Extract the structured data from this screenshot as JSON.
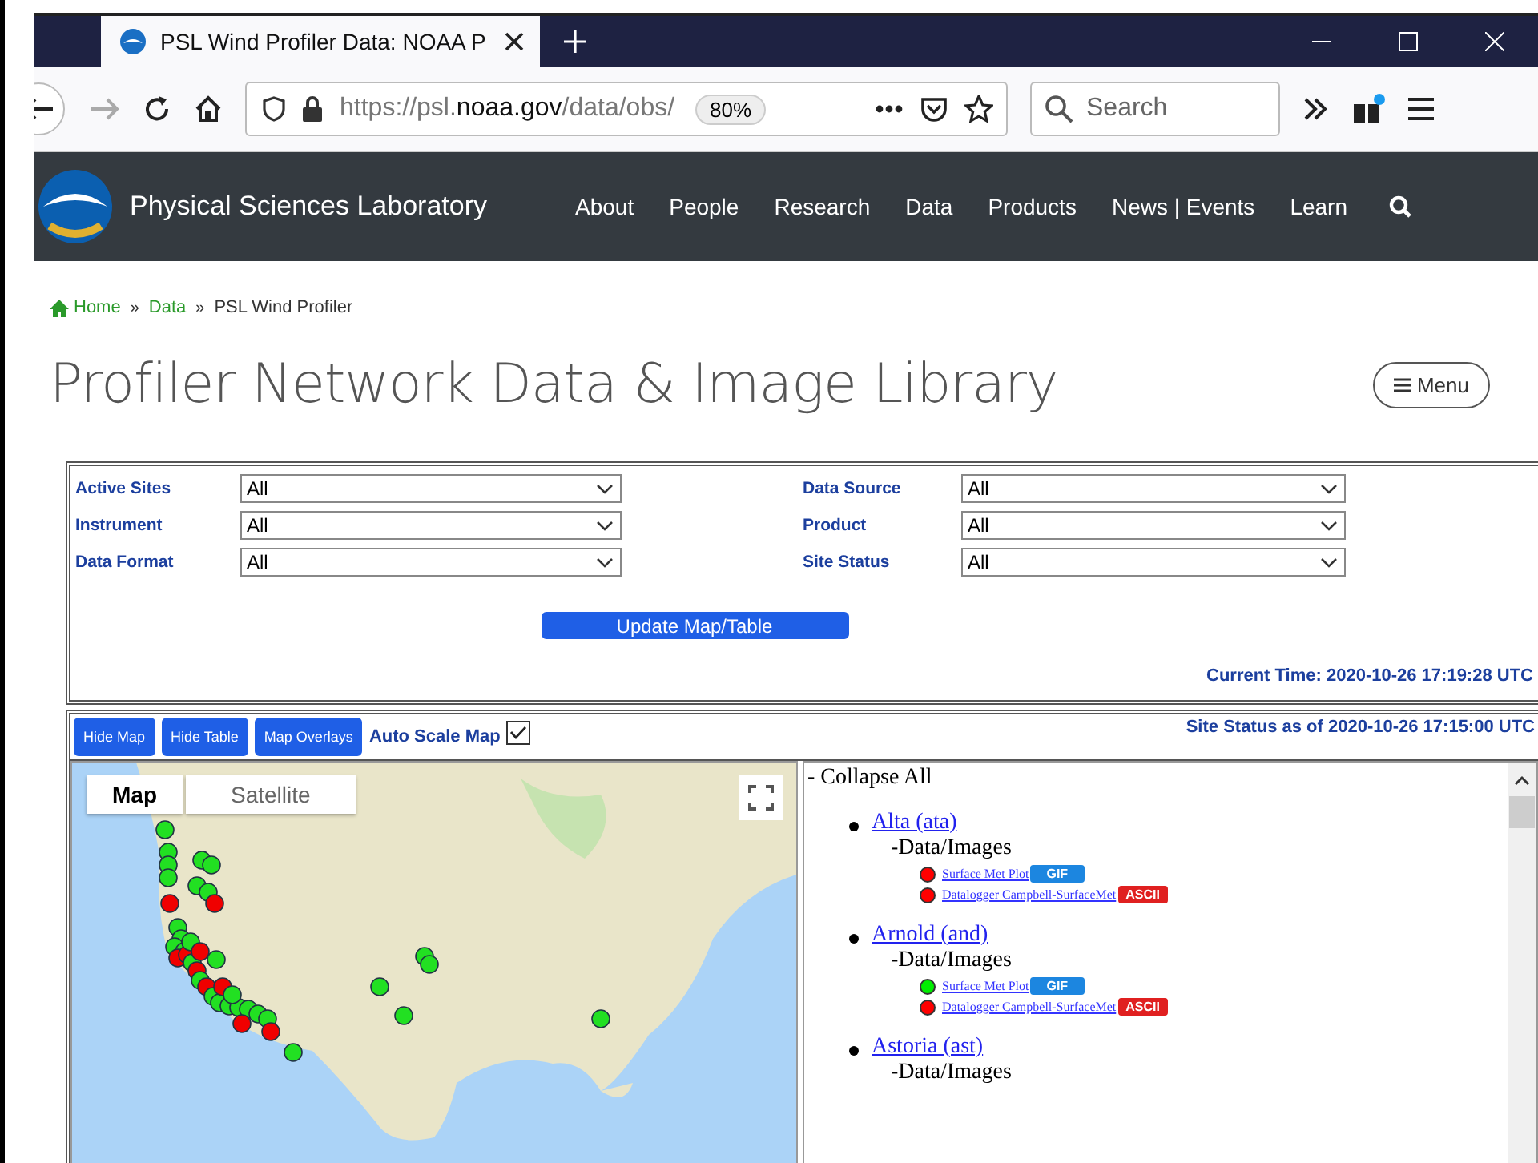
{
  "browser": {
    "tab_title": "PSL Wind Profiler Data: NOAA P",
    "url_parts": [
      {
        "text": "https://psl.",
        "emphasis": false
      },
      {
        "text": "noaa.gov",
        "emphasis": true
      },
      {
        "text": "/data/obs/",
        "emphasis": false
      }
    ],
    "zoom": "80%",
    "search": {
      "placeholder": "Search"
    }
  },
  "header": {
    "site_name": "Physical Sciences Laboratory",
    "nav": [
      "About",
      "People",
      "Research",
      "Data",
      "Products",
      "News | Events",
      "Learn"
    ]
  },
  "breadcrumb": [
    {
      "label": "Home",
      "link": true,
      "kind": "home"
    },
    {
      "label": "Data",
      "link": true,
      "kind": "plain"
    },
    {
      "label": "PSL Wind Profiler",
      "link": false,
      "kind": "plain"
    }
  ],
  "breadcrumb_separator": "»",
  "page_title": "Profiler Network Data & Image Library",
  "menu_button": "Menu",
  "filters": [
    {
      "label": "Active Sites",
      "value": "All"
    },
    {
      "label": "Instrument",
      "value": "All"
    },
    {
      "label": "Data Format",
      "value": "All"
    },
    {
      "label": "Data Source",
      "value": "All"
    },
    {
      "label": "Product",
      "value": "All"
    },
    {
      "label": "Site Status",
      "value": "All"
    }
  ],
  "update_button": "Update Map/Table",
  "current_time": "Current Time: 2020-10-26 17:19:28 UTC",
  "toolbar": {
    "buttons": [
      "Hide Map",
      "Hide Table",
      "Map Overlays"
    ],
    "auto_scale": {
      "label": "Auto Scale Map",
      "checked": true
    },
    "site_status": "Site Status as of 2020-10-26 17:15:00 UTC"
  },
  "map": {
    "tabs": [
      {
        "label": "Map",
        "selected": true
      },
      {
        "label": "Satellite",
        "selected": false
      }
    ]
  },
  "site_list": {
    "collapse": "- Collapse All",
    "sites": [
      {
        "name": "Alta (ata)",
        "group": "-Data/Images",
        "products": [
          {
            "name": "Surface Met Plot",
            "color": "#ff0000",
            "badge": "GIF",
            "kind": "gif"
          },
          {
            "name": "Datalogger Campbell-SurfaceMet",
            "color": "#ff0000",
            "badge": "ASCII",
            "kind": "ascii"
          }
        ]
      },
      {
        "name": "Arnold (and)",
        "group": "-Data/Images",
        "products": [
          {
            "name": "Surface Met Plot",
            "color": "#00ee00",
            "badge": "GIF",
            "kind": "gif"
          },
          {
            "name": "Datalogger Campbell-SurfaceMet",
            "color": "#ff0000",
            "badge": "ASCII",
            "kind": "ascii"
          }
        ]
      },
      {
        "name": "Astoria (ast)",
        "group": "-Data/Images"
      }
    ]
  }
}
